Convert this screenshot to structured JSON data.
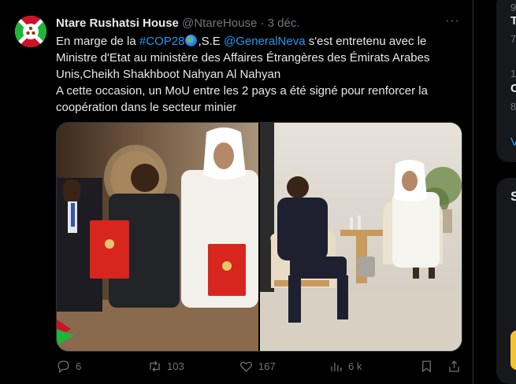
{
  "tweet": {
    "display_name": "Ntare Rushatsi House",
    "handle": "@NtareHouse",
    "separator": "·",
    "date": "3 déc.",
    "more_icon": "more-horizontal-icon",
    "text": {
      "p1_pre": "En marge de la ",
      "hashtag": "#COP28",
      "p1_mid": ",S.E ",
      "mention": "@GeneralNeva",
      "p1_post": " s'est entretenu avec le Ministre d'Etat au ministère des Affaires Étrangères des Émirats Arabes Unis,Cheikh Shakhboot Nahyan Al Nahyan",
      "p2": "A cette occasion, un MoU entre les 2 pays a été signé pour renforcer la coopération dans le secteur minier"
    },
    "media": {
      "photo_1": "photo-signing-ceremony",
      "photo_2": "photo-meeting-armchairs"
    },
    "actions": {
      "replies": "6",
      "retweets": "103",
      "likes": "167",
      "views": "6 k"
    }
  },
  "sidebar": {
    "fragments": [
      "9",
      "T",
      "7",
      "1",
      "C",
      "8",
      "V",
      "S"
    ]
  },
  "colors": {
    "background": "#000000",
    "text": "#e7e9ea",
    "muted": "#71767b",
    "link": "#1d9bf0",
    "border": "#2f3336"
  }
}
